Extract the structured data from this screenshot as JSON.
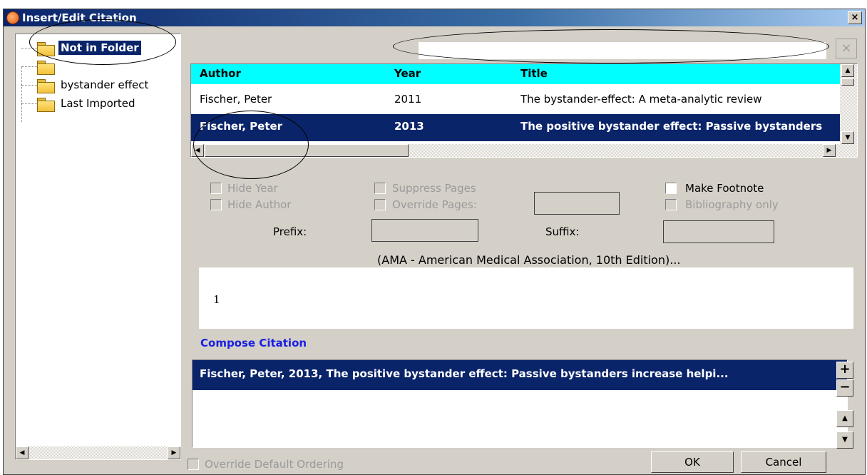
{
  "window": {
    "title": "Insert/Edit Citation",
    "close_glyph": "×"
  },
  "folders": [
    {
      "label": "Not in Folder",
      "selected": true
    },
    {
      "label": "",
      "selected": false
    },
    {
      "label": "bystander effect",
      "selected": false
    },
    {
      "label": "Last Imported",
      "selected": false
    }
  ],
  "search": {
    "value": "",
    "clear_glyph": "×"
  },
  "results": {
    "columns": [
      "Author",
      "Year",
      "Title"
    ],
    "rows": [
      {
        "author": "Fischer, Peter",
        "year": "2011",
        "title": "The bystander-effect: A meta-analytic review",
        "selected": false
      },
      {
        "author": "Fischer, Peter",
        "year": "2013",
        "title": "The positive bystander effect: Passive bystanders",
        "selected": true
      }
    ]
  },
  "options": {
    "hide_year": "Hide Year",
    "hide_author": "Hide Author",
    "suppress_pages": "Suppress Pages",
    "override_pages": "Override Pages:",
    "make_footnote": "Make Footnote",
    "bibliography_only": "Bibliography only",
    "prefix": "Prefix:",
    "suffix": "Suffix:"
  },
  "style_line": "(AMA - American Medical Association, 10th Edition)...",
  "preview": "1",
  "compose": {
    "link": "Compose Citation",
    "items": [
      "Fischer, Peter, 2013, The positive bystander effect: Passive bystanders increase helpi..."
    ]
  },
  "side_buttons": {
    "add": "+",
    "remove": "−",
    "up": "▲",
    "down": "▼"
  },
  "footer": {
    "override_ordering": "Override Default Ordering",
    "ok": "OK",
    "cancel": "Cancel"
  },
  "colors": {
    "title_bar": "#0a246a",
    "selection": "#0a246a",
    "header_bg": "#00ffff",
    "link": "#1a20e0"
  }
}
